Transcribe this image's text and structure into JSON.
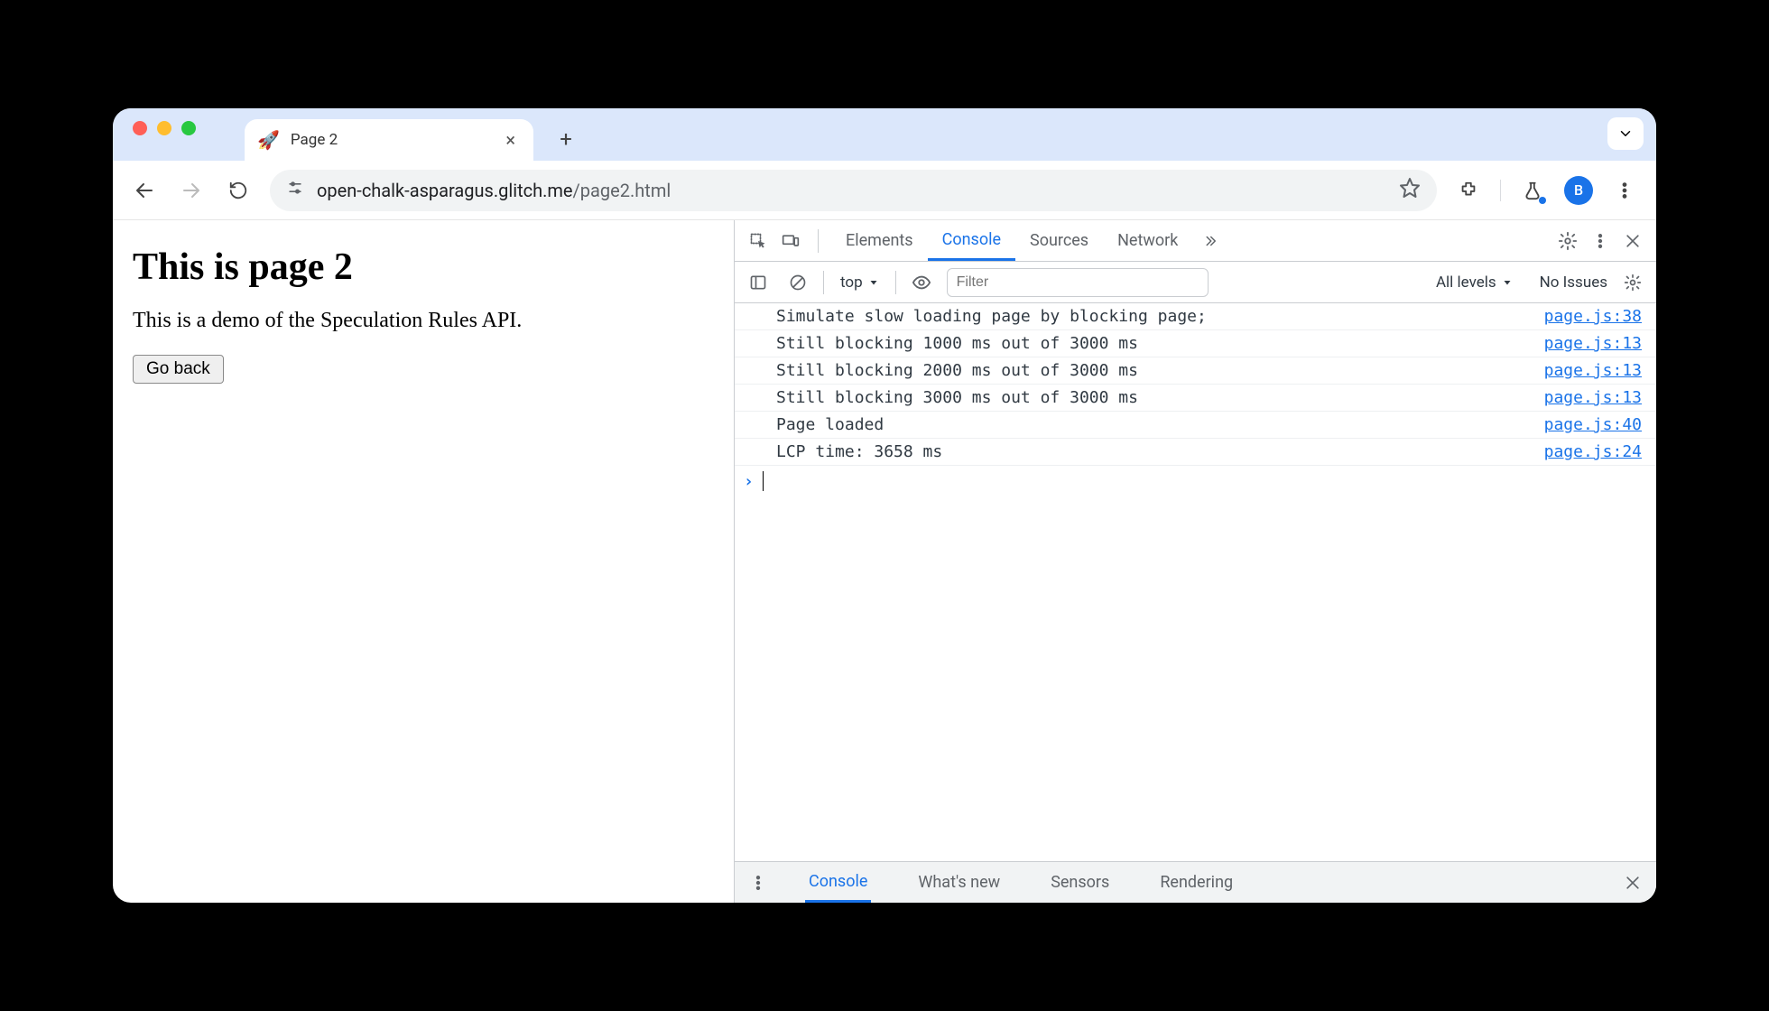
{
  "browser": {
    "tab": {
      "favicon": "🚀",
      "title": "Page 2"
    },
    "url": {
      "host": "open-chalk-asparagus.glitch.me",
      "path": "/page2.html"
    },
    "avatar_initial": "B"
  },
  "page": {
    "heading": "This is page 2",
    "body": "This is a demo of the Speculation Rules API.",
    "back_button": "Go back"
  },
  "devtools": {
    "tabs": [
      "Elements",
      "Console",
      "Sources",
      "Network"
    ],
    "active_tab": "Console",
    "context": "top",
    "filter_placeholder": "Filter",
    "levels_label": "All levels",
    "issues_label": "No Issues",
    "logs": [
      {
        "msg": "Simulate slow loading page by blocking page;",
        "src": "page.js:38"
      },
      {
        "msg": "Still blocking 1000 ms out of 3000 ms",
        "src": "page.js:13"
      },
      {
        "msg": "Still blocking 2000 ms out of 3000 ms",
        "src": "page.js:13"
      },
      {
        "msg": "Still blocking 3000 ms out of 3000 ms",
        "src": "page.js:13"
      },
      {
        "msg": "Page loaded",
        "src": "page.js:40"
      },
      {
        "msg": "LCP time: 3658 ms",
        "src": "page.js:24"
      }
    ],
    "drawer_tabs": [
      "Console",
      "What's new",
      "Sensors",
      "Rendering"
    ],
    "drawer_active": "Console"
  }
}
